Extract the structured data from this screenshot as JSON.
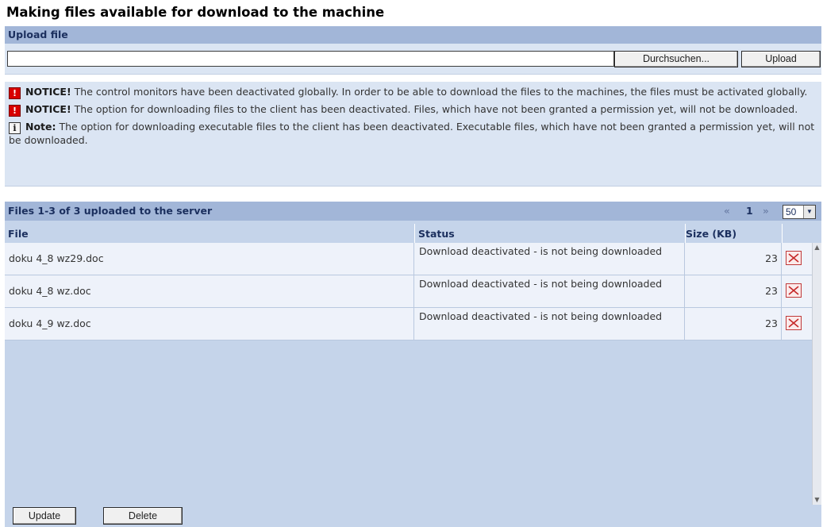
{
  "page": {
    "title": "Making files available for download to the machine"
  },
  "upload": {
    "header": "Upload file",
    "input_value": "",
    "browse_label": "Durchsuchen...",
    "upload_label": "Upload"
  },
  "notices": [
    {
      "icon": "!",
      "icon_name": "warning-icon",
      "label": "NOTICE!",
      "text": "The control monitors have been deactivated globally. In order to be able to download the files to the machines, the files must be activated globally."
    },
    {
      "icon": "!",
      "icon_name": "warning-icon",
      "label": "NOTICE!",
      "text": "The option for downloading files to the client has been deactivated. Files, which have not been granted a permission yet, will not be downloaded."
    },
    {
      "icon": "i",
      "icon_name": "info-icon",
      "label": "Note:",
      "text": "The option for downloading executable files to the client has been deactivated. Executable files, which have not been granted a permission yet, will not be downloaded."
    }
  ],
  "files": {
    "header": "Files 1-3 of 3 uploaded to the server",
    "pager": {
      "first": "«",
      "current": "1",
      "next": "»",
      "per_page": "50"
    },
    "columns": {
      "file": "File",
      "status": "Status",
      "size": "Size (KB)"
    },
    "rows": [
      {
        "file": "doku 4_8 wz29.doc",
        "status": "Download deactivated - is not being downloaded",
        "size": "23"
      },
      {
        "file": "doku 4_8 wz.doc",
        "status": "Download deactivated - is not being downloaded",
        "size": "23"
      },
      {
        "file": "doku 4_9 wz.doc",
        "status": "Download deactivated - is not being downloaded",
        "size": "23"
      }
    ],
    "actions": {
      "update_label": "Update",
      "delete_label": "Delete"
    }
  }
}
